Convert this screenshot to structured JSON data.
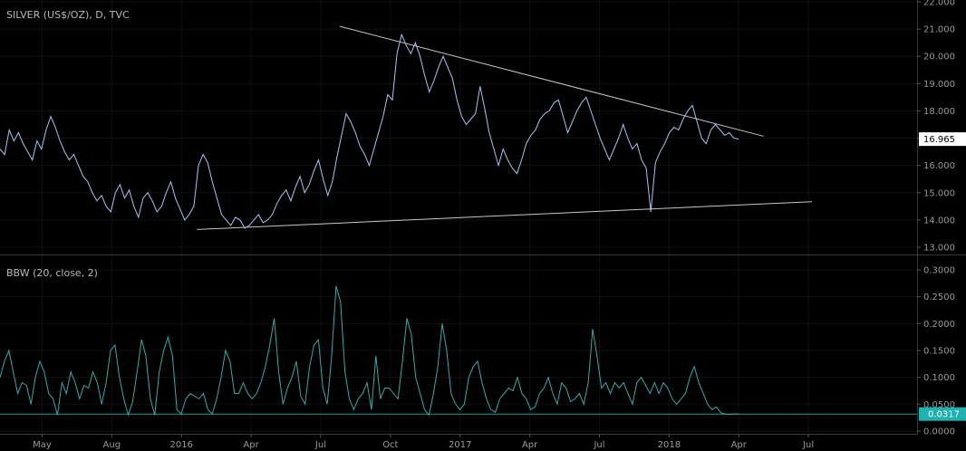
{
  "chart_data": [
    {
      "type": "line",
      "title": "SILVER (US$/OZ), D, TVC",
      "ylim": [
        13.0,
        22.0
      ],
      "y_ticks": [
        "13.000",
        "14.000",
        "15.000",
        "16.000",
        "17.000",
        "18.000",
        "19.000",
        "20.000",
        "21.000",
        "22.000"
      ],
      "x_ticks": [
        "May",
        "Aug",
        "2016",
        "Apr",
        "Jul",
        "Oct",
        "2017",
        "Apr",
        "Jul",
        "2018",
        "Apr",
        "Jul"
      ],
      "last_price": "16.965",
      "colors": {
        "price": "#a9c4f0",
        "trendline": "#c8c8c8",
        "tag_bg": "#ffffff",
        "tag_text": "#000000"
      },
      "series": [
        {
          "values": [
            16.6,
            16.4,
            17.3,
            16.9,
            17.2,
            16.8,
            16.5,
            16.2,
            16.9,
            16.6,
            17.3,
            17.8,
            17.4,
            16.9,
            16.5,
            16.2,
            16.4,
            16.0,
            15.6,
            15.4,
            15.0,
            14.7,
            14.9,
            14.5,
            14.3,
            15.0,
            15.3,
            14.8,
            15.1,
            14.5,
            14.1,
            14.8,
            15.0,
            14.7,
            14.3,
            14.5,
            15.0,
            15.4,
            14.8,
            14.4,
            14.0,
            14.2,
            14.5,
            16.0,
            16.4,
            16.1,
            15.4,
            14.8,
            14.2,
            14.0,
            13.8,
            14.1,
            14.0,
            13.7,
            13.8,
            14.0,
            14.2,
            13.9,
            14.0,
            14.2,
            14.6,
            14.9,
            15.1,
            14.7,
            15.2,
            15.6,
            15.0,
            15.3,
            15.8,
            16.2,
            15.5,
            14.9,
            15.4,
            16.3,
            17.1,
            17.9,
            17.6,
            17.2,
            16.7,
            16.4,
            16.0,
            16.6,
            17.2,
            17.8,
            18.6,
            18.4,
            20.1,
            20.8,
            20.4,
            20.1,
            20.5,
            20.0,
            19.3,
            18.7,
            19.1,
            19.6,
            20.0,
            19.6,
            19.2,
            18.4,
            17.8,
            17.5,
            17.7,
            17.9,
            18.9,
            18.1,
            17.2,
            16.6,
            16.0,
            16.6,
            16.2,
            15.9,
            15.7,
            16.2,
            16.8,
            17.1,
            17.3,
            17.7,
            17.9,
            18.0,
            18.3,
            18.4,
            17.8,
            17.2,
            17.6,
            18.0,
            18.3,
            18.5,
            18.0,
            17.5,
            17.0,
            16.6,
            16.2,
            16.6,
            17.0,
            17.5,
            17.0,
            16.6,
            16.8,
            16.2,
            15.9,
            14.3,
            16.1,
            16.5,
            16.8,
            17.2,
            17.4,
            17.3,
            17.7,
            18.0,
            18.2,
            17.6,
            17.0,
            16.8,
            17.3,
            17.5,
            17.3,
            17.1,
            17.2,
            17.0,
            16.97
          ]
        }
      ],
      "trendlines": [
        {
          "label": "upper",
          "points": [
            [
              0.3706,
              21.1
            ],
            [
              0.8326,
              17.07
            ]
          ]
        },
        {
          "label": "lower",
          "points": [
            [
              0.2148,
              13.65
            ],
            [
              0.8854,
              14.67
            ]
          ]
        }
      ]
    },
    {
      "type": "line",
      "title": "BBW (20, close, 2)",
      "ylim": [
        0.0,
        0.3
      ],
      "y_ticks": [
        "0.0000",
        "0.0500",
        "0.1000",
        "0.1500",
        "0.2000",
        "0.2500",
        "0.3000"
      ],
      "last_value": "0.0317",
      "colors": {
        "line": "#3aa8a8",
        "level": "#2b9595",
        "tag_bg": "#1fb0b0",
        "tag_text": "#ffffff"
      },
      "level": 0.0317,
      "series": [
        {
          "values": [
            0.1,
            0.13,
            0.15,
            0.11,
            0.07,
            0.09,
            0.085,
            0.05,
            0.1,
            0.13,
            0.11,
            0.07,
            0.06,
            0.03,
            0.09,
            0.07,
            0.11,
            0.09,
            0.06,
            0.085,
            0.08,
            0.11,
            0.09,
            0.05,
            0.09,
            0.15,
            0.16,
            0.1,
            0.06,
            0.03,
            0.055,
            0.11,
            0.17,
            0.14,
            0.06,
            0.03,
            0.11,
            0.15,
            0.175,
            0.14,
            0.04,
            0.032,
            0.06,
            0.07,
            0.065,
            0.06,
            0.07,
            0.04,
            0.032,
            0.06,
            0.1,
            0.15,
            0.13,
            0.07,
            0.07,
            0.09,
            0.07,
            0.06,
            0.07,
            0.09,
            0.12,
            0.16,
            0.21,
            0.11,
            0.05,
            0.08,
            0.1,
            0.13,
            0.065,
            0.05,
            0.12,
            0.16,
            0.17,
            0.08,
            0.05,
            0.14,
            0.27,
            0.24,
            0.11,
            0.06,
            0.04,
            0.06,
            0.07,
            0.09,
            0.04,
            0.14,
            0.06,
            0.08,
            0.08,
            0.07,
            0.06,
            0.13,
            0.21,
            0.18,
            0.1,
            0.07,
            0.04,
            0.03,
            0.07,
            0.12,
            0.2,
            0.15,
            0.07,
            0.05,
            0.04,
            0.05,
            0.1,
            0.12,
            0.13,
            0.09,
            0.06,
            0.04,
            0.035,
            0.06,
            0.07,
            0.08,
            0.075,
            0.1,
            0.07,
            0.06,
            0.04,
            0.045,
            0.07,
            0.08,
            0.1,
            0.07,
            0.05,
            0.09,
            0.08,
            0.055,
            0.06,
            0.07,
            0.05,
            0.09,
            0.19,
            0.14,
            0.08,
            0.09,
            0.07,
            0.09,
            0.08,
            0.09,
            0.07,
            0.05,
            0.09,
            0.1,
            0.085,
            0.07,
            0.09,
            0.07,
            0.09,
            0.08,
            0.06,
            0.05,
            0.06,
            0.07,
            0.1,
            0.12,
            0.09,
            0.07,
            0.05,
            0.04,
            0.045,
            0.034,
            0.032,
            0.031,
            0.032,
            0.0317
          ]
        }
      ]
    }
  ]
}
